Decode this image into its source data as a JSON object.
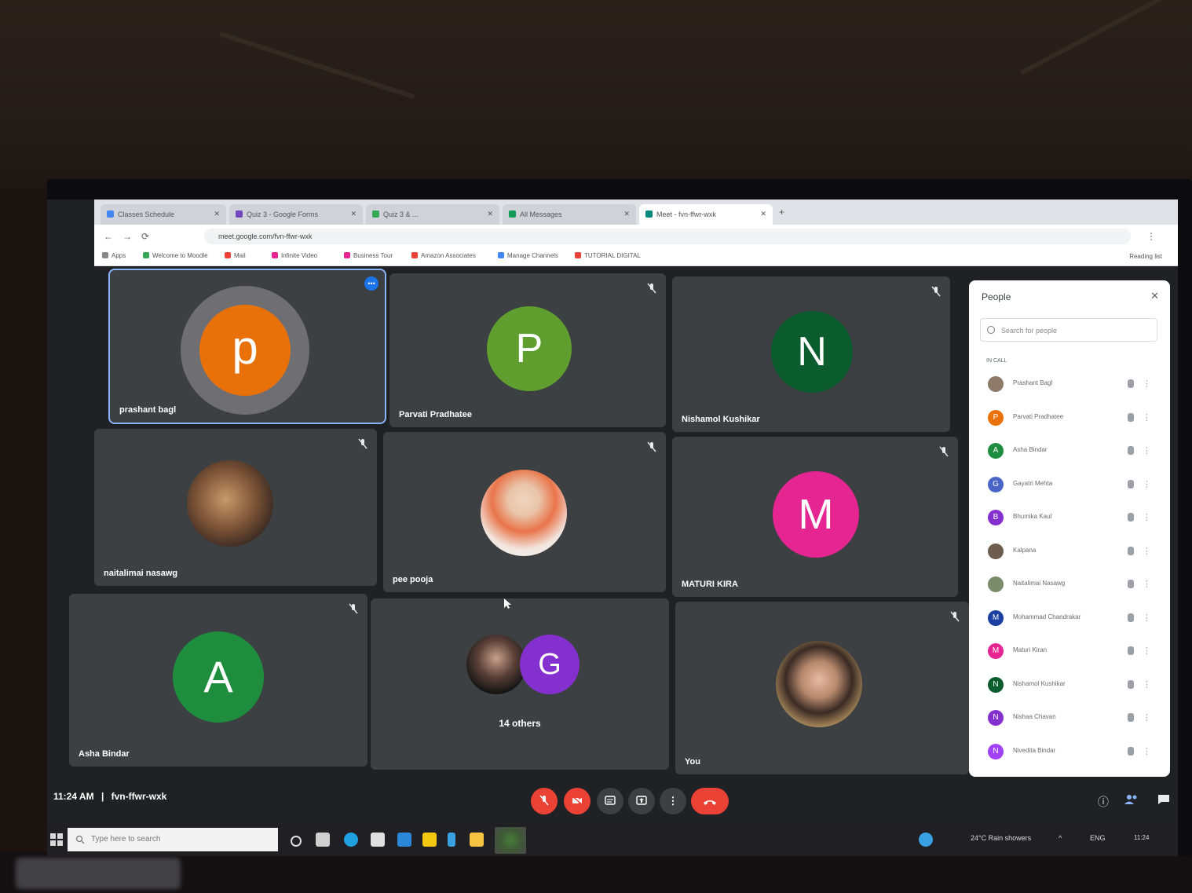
{
  "browser": {
    "tabs": [
      "Classes Schedule",
      "Quiz 3 - Google Forms",
      "Quiz 3 & ...",
      "All Messages",
      "Meet - fvn-ffwr-wxk"
    ],
    "url": "meet.google.com/fvn-ffwr-wxk",
    "bookmarks": [
      "Apps",
      "Welcome to Moodle",
      "Mail",
      "Infinite Video",
      "Business Tour",
      "Amazon Associates",
      "Manage Channels",
      "TUTORIAL DIGITAL"
    ],
    "reading_list": "Reading list"
  },
  "meeting": {
    "time": "11:24 AM",
    "separator": "|",
    "code": "fvn-ffwr-wxk",
    "tiles": [
      {
        "initial": "p",
        "name": "prashant bagl",
        "color": "#e8710a"
      },
      {
        "initial": "P",
        "name": "Parvati Pradhatee",
        "color": "#5f9e2f"
      },
      {
        "initial": "N",
        "name": "Nishamol Kushikar",
        "color": "#0b5d2e"
      },
      {
        "initial": "",
        "name": "naitalimai nasawg",
        "color": "#5a4a3a"
      },
      {
        "initial": "",
        "name": "pee pooja",
        "color": "#e9d8cc"
      },
      {
        "initial": "M",
        "name": "MATURI KIRA",
        "color": "#e52592"
      },
      {
        "initial": "A",
        "name": "Asha Bindar",
        "color": "#1e8e3e"
      },
      {
        "initial": "G",
        "name": "14 others",
        "color": "#8430ce"
      },
      {
        "initial": "",
        "name": "You",
        "color": "#c9a188"
      }
    ]
  },
  "people_panel": {
    "title": "People",
    "search_placeholder": "Search for people",
    "section": "IN CALL",
    "participants": [
      {
        "initial": "",
        "name": "Prashant Bagl",
        "color": "#8d7a68"
      },
      {
        "initial": "P",
        "name": "Parvati Pradhatee",
        "color": "#e8710a"
      },
      {
        "initial": "A",
        "name": "Asha Bindar",
        "color": "#1e8e3e"
      },
      {
        "initial": "G",
        "name": "Gayatri Mehta",
        "color": "#4a64c8"
      },
      {
        "initial": "B",
        "name": "Bhumika Kaul",
        "color": "#8430ce"
      },
      {
        "initial": "",
        "name": "Kalpana",
        "color": "#6d5d4f"
      },
      {
        "initial": "",
        "name": "Naitalimai Nasawg",
        "color": "#7a8a6a"
      },
      {
        "initial": "M",
        "name": "Mohammad Chandrakar",
        "color": "#1a3ea1"
      },
      {
        "initial": "M",
        "name": "Maturi Kiran",
        "color": "#e52592"
      },
      {
        "initial": "N",
        "name": "Nishamol Kushikar",
        "color": "#0b5d2e"
      },
      {
        "initial": "N",
        "name": "Nishaa Chavan",
        "color": "#8430ce"
      },
      {
        "initial": "N",
        "name": "Nivedita Bindar",
        "color": "#a142f4"
      }
    ]
  },
  "taskbar": {
    "search_placeholder": "Type here to search",
    "weather": "24°C  Rain showers",
    "lang": "ENG",
    "clock": "11:24"
  }
}
